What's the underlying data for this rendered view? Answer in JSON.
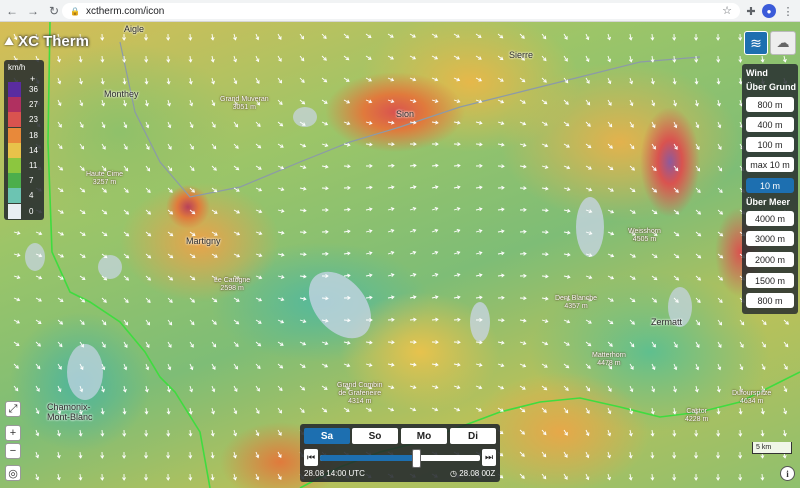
{
  "browser": {
    "url": "xctherm.com/icon",
    "back_icon": "arrow-left",
    "forward_icon": "arrow-right",
    "reload_icon": "reload"
  },
  "app": {
    "name": "XC Therm"
  },
  "legend": {
    "unit": "km/h",
    "plus": "+",
    "levels": [
      {
        "label": "36",
        "color": "#5a2ca0"
      },
      {
        "label": "27",
        "color": "#b03060"
      },
      {
        "label": "23",
        "color": "#d9534f"
      },
      {
        "label": "18",
        "color": "#e8893a"
      },
      {
        "label": "14",
        "color": "#e8c24a"
      },
      {
        "label": "11",
        "color": "#8cc63f"
      },
      {
        "label": "7",
        "color": "#4cae4c"
      },
      {
        "label": "4",
        "color": "#6cc4b2"
      },
      {
        "label": "0",
        "color": "#e8eef2"
      }
    ]
  },
  "layers": {
    "wind_icon": "wind-icon",
    "cloud_icon": "cloud-icon"
  },
  "altitude": {
    "section_wind": "Wind",
    "section_ground": "Über Grund",
    "ground_options": [
      "800 m",
      "400 m",
      "100 m",
      "max 10 m",
      "10 m"
    ],
    "active_option": "10 m",
    "section_sea": "Über Meer",
    "sea_options": [
      "4000 m",
      "3000 m",
      "2000 m",
      "1500 m",
      "800 m"
    ]
  },
  "map_controls": {
    "fullscreen": "⤢",
    "zoom_in": "+",
    "zoom_out": "−",
    "locate": "◎"
  },
  "places": [
    {
      "name": "Aigle"
    },
    {
      "name": "Sierre"
    },
    {
      "name": "Monthey"
    },
    {
      "name": "Sion"
    },
    {
      "name": "Martigny"
    },
    {
      "name": "Zermatt"
    },
    {
      "name": "Chamonix-\nMont-Blanc"
    }
  ],
  "peaks": [
    {
      "name": "Grand Muveran",
      "elev": "3051 m"
    },
    {
      "name": "Haute Cime",
      "elev": "3257 m"
    },
    {
      "name": "Le Catogne",
      "elev": "2598 m"
    },
    {
      "name": "Weisshorn",
      "elev": "4505 m"
    },
    {
      "name": "Dent Blanche",
      "elev": "4357 m"
    },
    {
      "name": "Matterhorn",
      "elev": "4478 m"
    },
    {
      "name": "Grand Combin\nde Grafeneire",
      "elev": "4314 m"
    },
    {
      "name": "Castor",
      "elev": "4228 m"
    },
    {
      "name": "Dufourspitze",
      "elev": "4634 m"
    }
  ],
  "time": {
    "days": [
      "Sa",
      "So",
      "Mo",
      "Di"
    ],
    "active_day": "Sa",
    "current": "28.08 14:00 UTC",
    "run": "28.08 00Z",
    "progress": 0.6
  },
  "scale": "5 km",
  "info": "i"
}
